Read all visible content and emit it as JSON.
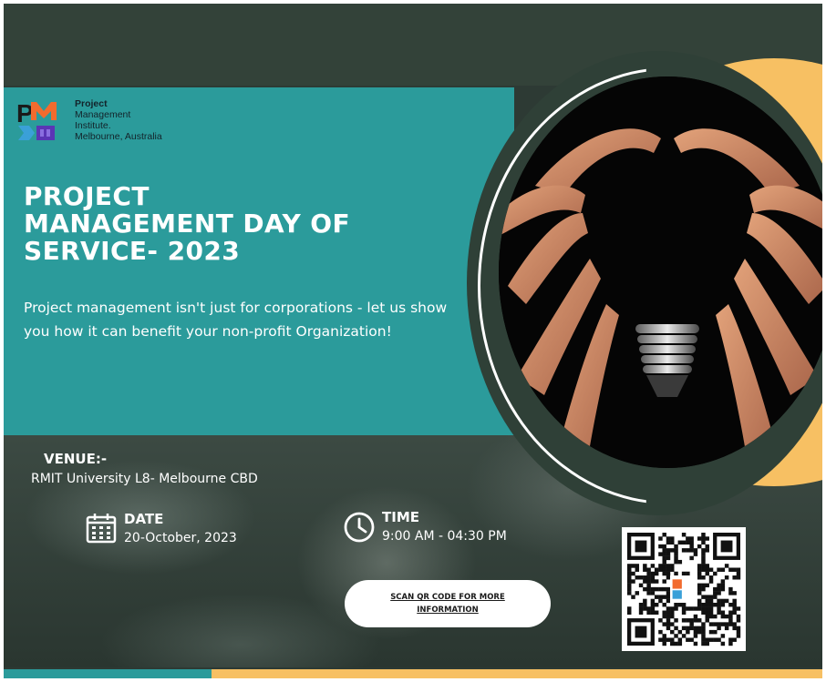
{
  "organization": {
    "logo_letters": "PMI",
    "name_line1": "Project",
    "name_rest": "Management\nInstitute.\nMelbourne, Australia"
  },
  "event": {
    "title_lines": [
      "PROJECT",
      "MANAGEMENT DAY OF",
      "SERVICE- 2023"
    ],
    "subtitle": "Project management isn't just for corporations - let us show you how it can benefit your non-profit Organization!"
  },
  "venue": {
    "label": "VENUE:-",
    "value": "RMIT University L8- Melbourne CBD"
  },
  "date": {
    "label": "DATE",
    "value": "20-October, 2023",
    "icon": "calendar-icon"
  },
  "time": {
    "label": "TIME",
    "value": "9:00 AM - 04:30 PM",
    "icon": "clock-icon"
  },
  "cta": {
    "label": "SCAN QR CODE FOR MORE INFORMATION"
  },
  "qr": {
    "icon": "qr-code"
  },
  "colors": {
    "teal": "#2b9b9b",
    "yellow": "#f7c063",
    "dark_green": "#2f4037",
    "white": "#ffffff"
  }
}
